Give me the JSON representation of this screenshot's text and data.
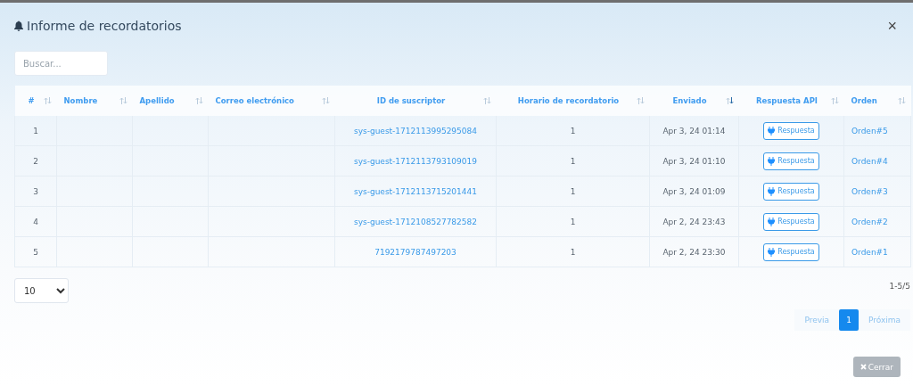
{
  "window": {
    "title": "Informe de recordatorios",
    "close": "×"
  },
  "search": {
    "placeholder": "Buscar..."
  },
  "table": {
    "columns": [
      {
        "label": "#",
        "sorted": false
      },
      {
        "label": "Nombre",
        "sorted": false
      },
      {
        "label": "Apellido",
        "sorted": false
      },
      {
        "label": "Correo electrónico",
        "sorted": false
      },
      {
        "label": "ID de suscriptor",
        "sorted": false
      },
      {
        "label": "Horario de recordatorio",
        "sorted": false
      },
      {
        "label": "Enviado",
        "sorted": true
      },
      {
        "label": "Respuesta API",
        "sorted": false
      },
      {
        "label": "Orden",
        "sorted": false
      }
    ],
    "rows": [
      {
        "index": "1",
        "subscriber": "sys-guest-1712113995295084",
        "schedule": "1",
        "sent": "Apr 3, 24 01:14",
        "response": "Respuesta",
        "order": "Orden#5"
      },
      {
        "index": "2",
        "subscriber": "sys-guest-1712113793109019",
        "schedule": "1",
        "sent": "Apr 3, 24 01:10",
        "response": "Respuesta",
        "order": "Orden#4"
      },
      {
        "index": "3",
        "subscriber": "sys-guest-1712113715201441",
        "schedule": "1",
        "sent": "Apr 3, 24 01:09",
        "response": "Respuesta",
        "order": "Orden#3"
      },
      {
        "index": "4",
        "subscriber": "sys-guest-1712108527782582",
        "schedule": "1",
        "sent": "Apr 2, 24 23:43",
        "response": "Respuesta",
        "order": "Orden#2"
      },
      {
        "index": "5",
        "subscriber": "7192179787497203",
        "schedule": "1",
        "sent": "Apr 2, 24 23:30",
        "response": "Respuesta",
        "order": "Orden#1"
      }
    ]
  },
  "page_size": {
    "value": "10"
  },
  "range": "1-5/5",
  "pagination": {
    "previous": {
      "label": "Previa",
      "disabled": true
    },
    "pages": [
      {
        "label": "1",
        "selected": true
      }
    ],
    "next": {
      "label": "Próxima",
      "disabled": true
    }
  },
  "close_button": {
    "label": "Cerrar"
  }
}
